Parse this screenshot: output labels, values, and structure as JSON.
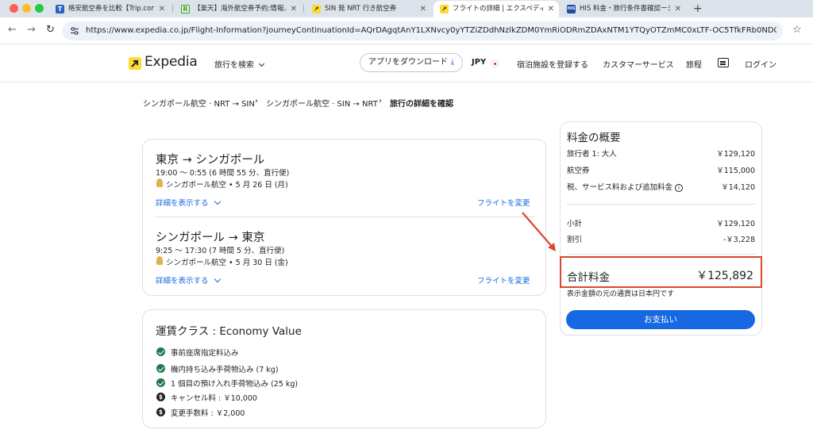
{
  "browser": {
    "tabs": [
      {
        "title": "格安航空券を比較【Trip.com】",
        "favicon": "T"
      },
      {
        "title": "【楽天】海外航空券予約:情報入力",
        "favicon": "R"
      },
      {
        "title": "SIN 発 NRT 行き航空券",
        "favicon": ""
      },
      {
        "title": "フライトの詳細 | エクスペディア",
        "favicon": ""
      },
      {
        "title": "HIS 料金・旅行条件書確認ーシン",
        "favicon": "HIS"
      }
    ],
    "url": "https://www.expedia.co.jp/Flight-Information?journeyContinuationId=AQrDAgqtAnY1LXNvcy0yYTZiZDdhNzlkZDM0YmRiODRmZDAxNTM1YTQyOTZmMC0xLTF-OC5TfkFRb0NDQndTQndqcGF4QUZ"
  },
  "header": {
    "logo": "Expedia",
    "search_travel": "旅行を検索",
    "app_download": "アプリをダウンロード",
    "currency": "JPY",
    "list_property": "宿泊施設を登録する",
    "customer_service": "カスタマーサービス",
    "trips": "旅程",
    "login": "ログイン"
  },
  "breadcrumb": {
    "step1": "シンガポール航空 · NRT → SIN",
    "step2": "シンガポール航空 · SIN → NRT",
    "current": "旅行の詳細を確認"
  },
  "flights": [
    {
      "route": "東京 → シンガポール",
      "time": "19:00 〜 0:55 (6 時間 55 分、直行便)",
      "airline_date": "シンガポール航空 • 5 月 26 日 (月)",
      "details_link": "詳細を表示する",
      "change_link": "フライトを変更"
    },
    {
      "route": "シンガポール → 東京",
      "time": "9:25 〜 17:30 (7 時間 5 分、直行便)",
      "airline_date": "シンガポール航空 • 5 月 30 日 (金)",
      "details_link": "詳細を表示する",
      "change_link": "フライトを変更"
    }
  ],
  "fare": {
    "title": "運賃クラス : Economy Value",
    "features": [
      "事前座席指定料込み",
      "機内持ち込み手荷物込み (7 kg)",
      "1 個目の預け入れ手荷物込み (25 kg)"
    ],
    "fees": [
      "キャンセル料 : ￥10,000",
      "変更手数料 : ￥2,000"
    ]
  },
  "price_summary": {
    "title": "料金の概要",
    "traveler_label": "旅行者 1: 大人",
    "traveler_value": "￥129,120",
    "ticket_label": "航空券",
    "ticket_value": "￥115,000",
    "tax_label": "税、サービス料および追加料金",
    "tax_value": "￥14,120",
    "subtotal_label": "小計",
    "subtotal_value": "￥129,120",
    "discount_label": "割引",
    "discount_value": "-￥3,228",
    "total_label": "合計料金",
    "total_value": "￥125,892",
    "currency_note": "表示金額の元の通貨は日本円です",
    "pay_button": "お支払い"
  },
  "colors": {
    "accent_blue": "#1668e3",
    "annotation_red": "#d9482b",
    "check_green": "#227950",
    "logo_yellow": "#fddb32"
  }
}
